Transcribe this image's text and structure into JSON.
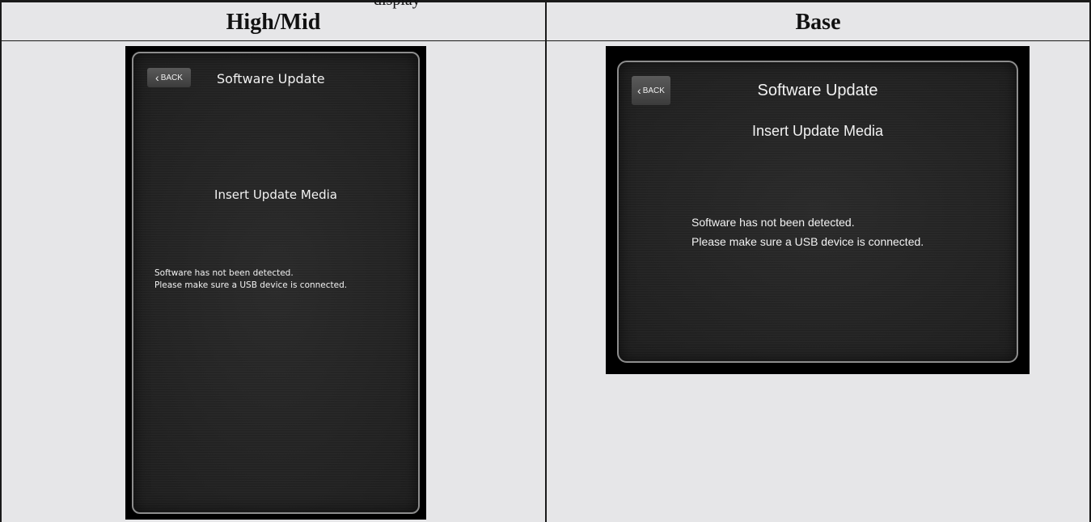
{
  "page": {
    "top_text_fragment": "display"
  },
  "columns": [
    {
      "header": "High/Mid",
      "screen": {
        "back_label": "BACK",
        "title": "Software Update",
        "subtitle": "Insert Update Media",
        "message_line1": "Software has not been detected.",
        "message_line2": "Please make sure a USB device is connected."
      }
    },
    {
      "header": "Base",
      "screen": {
        "back_label": "BACK",
        "title": "Software Update",
        "subtitle": "Insert Update Media",
        "message_line1": "Software has not been detected.",
        "message_line2": "Please make sure a USB device is connected."
      }
    }
  ]
}
